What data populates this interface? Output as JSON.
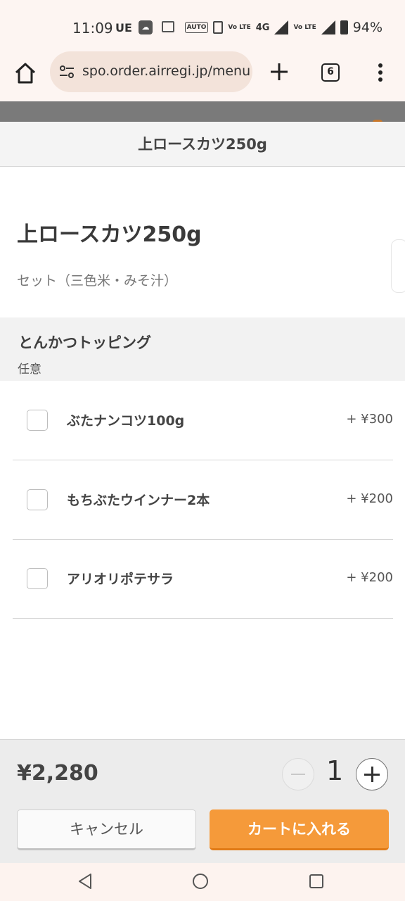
{
  "status_bar": {
    "time": "11:09",
    "carrier_icon": "UE",
    "icons": [
      "cloud-app-icon",
      "gallery-icon",
      "auto-hz-icon",
      "vibrate-icon",
      "volte-icon",
      "4g-icon",
      "signal-icon",
      "volte2-icon",
      "signal2-icon",
      "battery-icon"
    ],
    "auto_label": "AUTO",
    "volte_label": "Vo LTE",
    "network_label": "4G",
    "battery": "94%"
  },
  "browser": {
    "url": "spo.order.airregi.jp/menu",
    "tab_count": "6"
  },
  "modal": {
    "header_title": "上ロースカツ250g",
    "item_name": "上ロースカツ250g",
    "item_description": "セット（三色米・みそ汁）",
    "option_group": {
      "title": "とんかつトッピング",
      "requirement": "任意",
      "options": [
        {
          "name": "ぶたナンコツ100g",
          "price": "+ ¥300",
          "checked": false
        },
        {
          "name": "もちぶたウインナー2本",
          "price": "+ ¥200",
          "checked": false
        },
        {
          "name": "アリオリポテサラ",
          "price": "+ ¥200",
          "checked": false
        }
      ]
    }
  },
  "footer": {
    "total": "¥2,280",
    "quantity": "1",
    "cancel_label": "キャンセル",
    "add_to_cart_label": "カートに入れる"
  },
  "colors": {
    "accent": "#f59a3a",
    "browser_chrome": "#fdf5f2",
    "url_bar": "#f3e3da"
  }
}
